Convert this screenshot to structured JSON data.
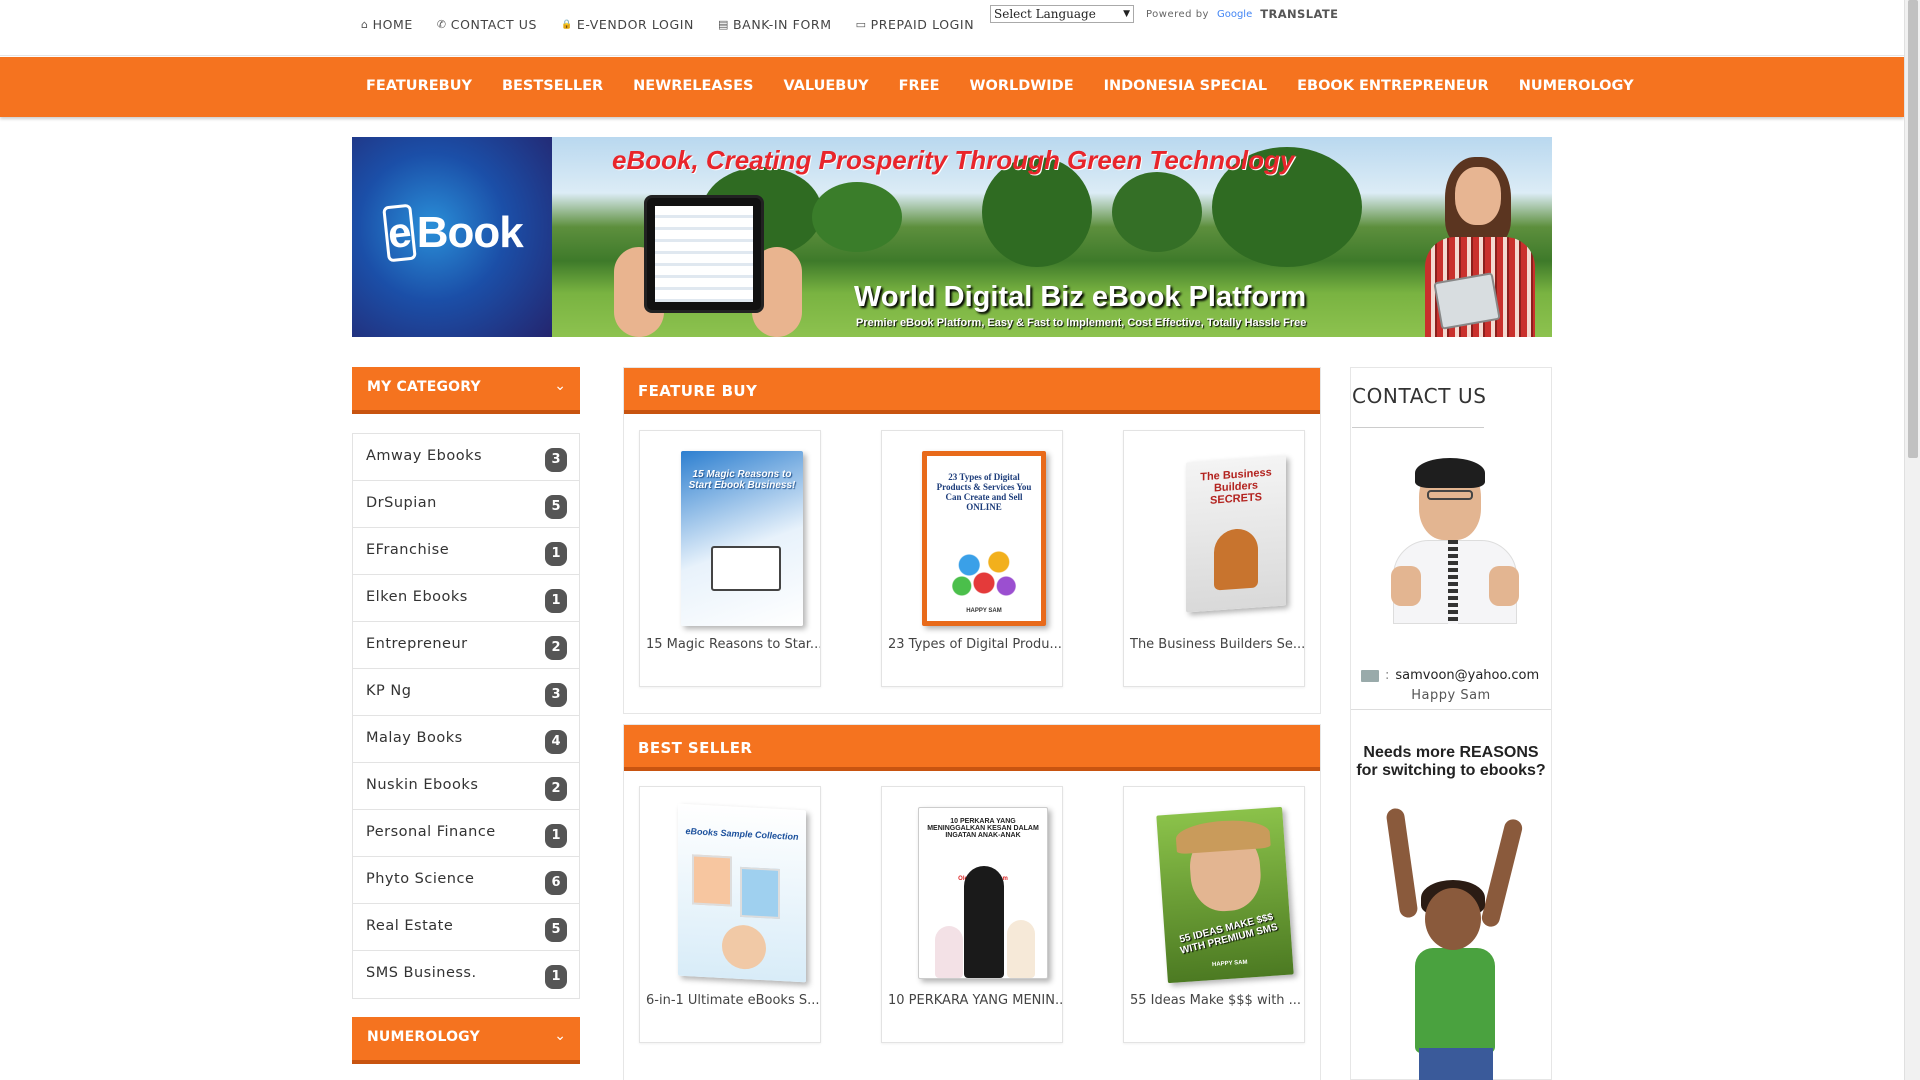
{
  "topbar": {
    "links": [
      {
        "icon": "home-icon",
        "glyph": "⌂",
        "label": "HOME"
      },
      {
        "icon": "phone-icon",
        "glyph": "✆",
        "label": "CONTACT US"
      },
      {
        "icon": "lock-icon",
        "glyph": "🔒",
        "label": "E-VENDOR LOGIN"
      },
      {
        "icon": "document-icon",
        "glyph": "▤",
        "label": "BANK-IN FORM"
      },
      {
        "icon": "credit-card-icon",
        "glyph": "▭",
        "label": "PREPAID LOGIN"
      }
    ],
    "language_select": "Select Language",
    "powered_by": "Powered by",
    "google_logo": "Google",
    "translate": "TRANSLATE"
  },
  "nav": {
    "items": [
      "FEATUREBUY",
      "BESTSELLER",
      "NEWRELEASES",
      "VALUEBUY",
      "FREE",
      "WORLDWIDE",
      "INDONESIA SPECIAL",
      "EBOOK ENTREPRENEUR",
      "NUMEROLOGY"
    ]
  },
  "banner": {
    "logo_e": "e",
    "logo_rest": "Book",
    "tagline": "eBook, Creating Prosperity Through Green Technology",
    "title": "World Digital Biz eBook Platform",
    "subtitle": "Premier eBook Platform, Easy & Fast to Implement, Cost Effective, Totally Hassle Free"
  },
  "sidebar": {
    "category_title": "MY CATEGORY",
    "categories": [
      {
        "name": "Amway Ebooks",
        "count": "3"
      },
      {
        "name": "DrSupian",
        "count": "5"
      },
      {
        "name": "EFranchise",
        "count": "1"
      },
      {
        "name": "Elken Ebooks",
        "count": "1"
      },
      {
        "name": "Entrepreneur",
        "count": "2"
      },
      {
        "name": "KP Ng",
        "count": "3"
      },
      {
        "name": "Malay Books",
        "count": "4"
      },
      {
        "name": "Nuskin Ebooks",
        "count": "2"
      },
      {
        "name": "Personal Finance",
        "count": "1"
      },
      {
        "name": "Phyto Science",
        "count": "6"
      },
      {
        "name": "Real Estate",
        "count": "5"
      },
      {
        "name": "SMS Business.",
        "count": "1"
      }
    ],
    "numerology_title": "NUMEROLOGY",
    "chevron": "⌄"
  },
  "feature_buy": {
    "title": "FEATURE BUY",
    "books": [
      {
        "title": "15 Magic Reasons to Star...",
        "cover_text": "15 Magic Reasons to Start Ebook Business!"
      },
      {
        "title": "23 Types of Digital Produ...",
        "cover_text": "23 Types of Digital Products & Services You Can Create and Sell ONLINE",
        "cover_author": "HAPPY SAM"
      },
      {
        "title": "The Business Builders Se...",
        "cover_text": "The Business Builders SECRETS"
      }
    ]
  },
  "best_seller": {
    "title": "BEST SELLER",
    "books": [
      {
        "title": "6-in-1 Ultimate eBooks S...",
        "cover_text": "eBooks Sample Collection"
      },
      {
        "title": "10 PERKARA YANG MENIN...",
        "cover_text": "10 PERKARA YANG MENINGGALKAN KESAN DALAM INGATAN ANAK-ANAK",
        "cover_author": "Oleh: Happy Sam"
      },
      {
        "title": "55 Ideas Make $$$ with ...",
        "cover_text": "55 IDEAS MAKE $$$ WITH PREMIUM SMS",
        "cover_author": "HAPPY SAM"
      }
    ]
  },
  "contact": {
    "title": "CONTACT US",
    "email_sep": ":",
    "email": "samvoon@yahoo.com",
    "name": "Happy Sam",
    "reasons": "Needs more REASONS for switching to ebooks?"
  },
  "colors": {
    "accent": "#f5731f",
    "accent_dark": "#c85410",
    "badge": "#555555"
  }
}
